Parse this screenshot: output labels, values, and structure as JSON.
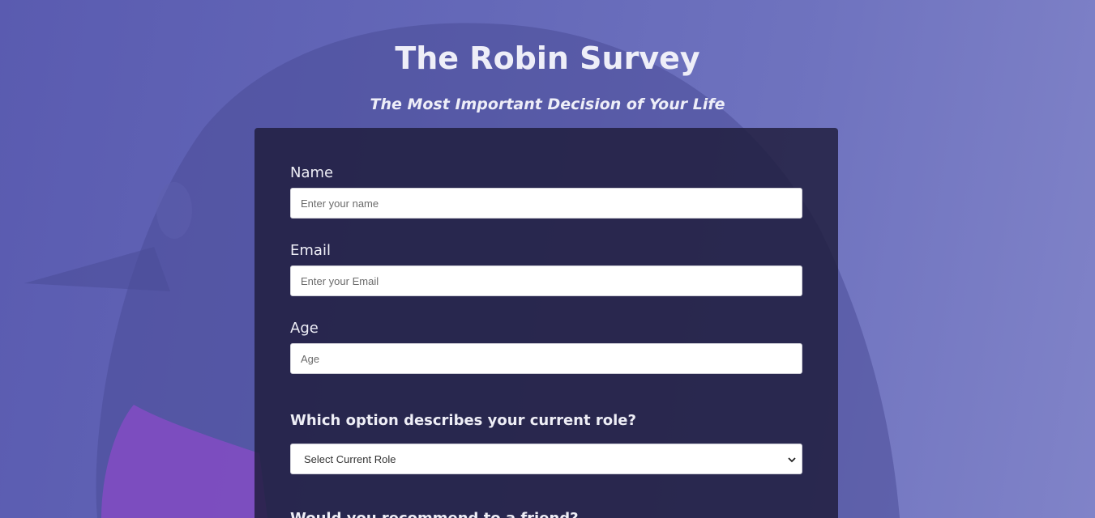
{
  "header": {
    "title": "The Robin Survey",
    "subtitle": "The Most Important Decision of Your Life"
  },
  "form": {
    "name": {
      "label": "Name",
      "placeholder": "Enter your name",
      "value": ""
    },
    "email": {
      "label": "Email",
      "placeholder": "Enter your Email",
      "value": ""
    },
    "age": {
      "label": "Age",
      "placeholder": "Age",
      "value": ""
    },
    "role_question": "Which option describes your current role?",
    "role_select": {
      "selected": "Select Current Role"
    },
    "next_question": "Would you recommend to a friend?"
  },
  "colors": {
    "background": "#6468b8",
    "card": "#1e1c3a",
    "text": "#eeeef6"
  }
}
